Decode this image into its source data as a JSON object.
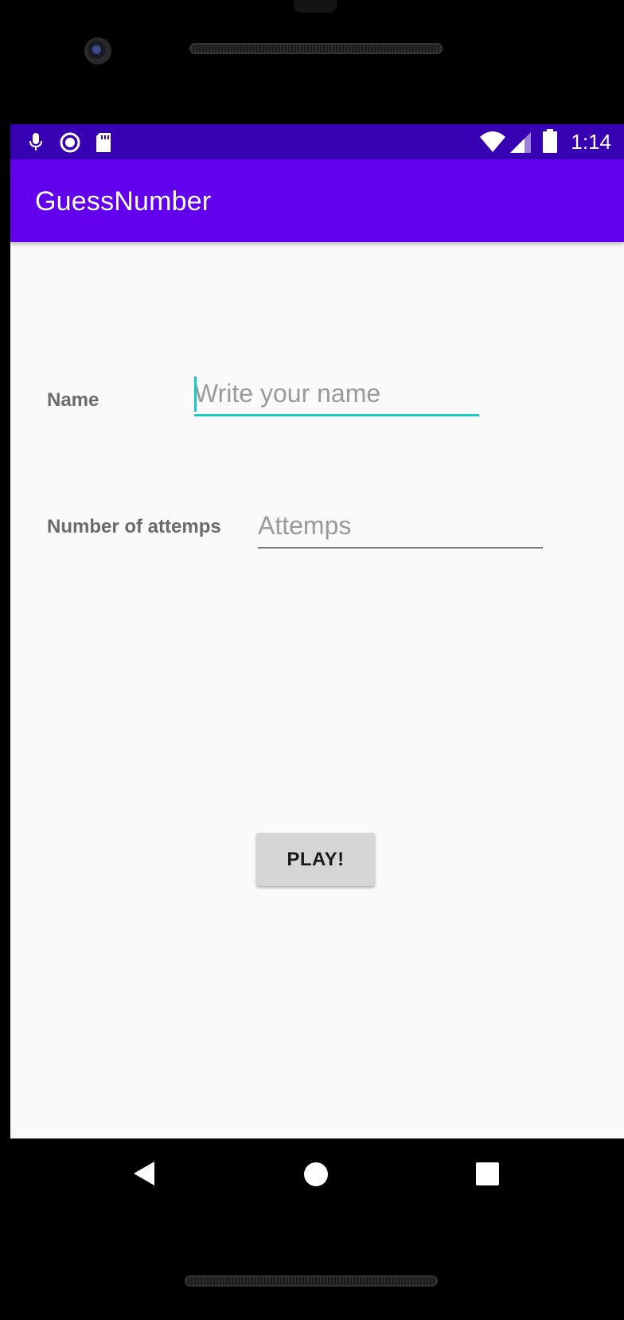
{
  "status_bar": {
    "time": "1:14",
    "icons": [
      "microphone-icon",
      "screen-record-icon",
      "sd-card-icon",
      "wifi-icon",
      "signal-icon",
      "battery-icon"
    ]
  },
  "app_bar": {
    "title": "GuessNumber",
    "color": "#6200ee",
    "status_color": "#3700b3"
  },
  "form": {
    "name_label": "Name",
    "name_placeholder": "Write your name",
    "name_value": "",
    "attempts_label": "Number of attemps",
    "attempts_placeholder": "Attemps",
    "attempts_value": "",
    "accent_color": "#18c9c4"
  },
  "actions": {
    "play_label": "PLAY!"
  },
  "nav_bar": {
    "icons": [
      "back-icon",
      "home-icon",
      "recents-icon"
    ]
  }
}
